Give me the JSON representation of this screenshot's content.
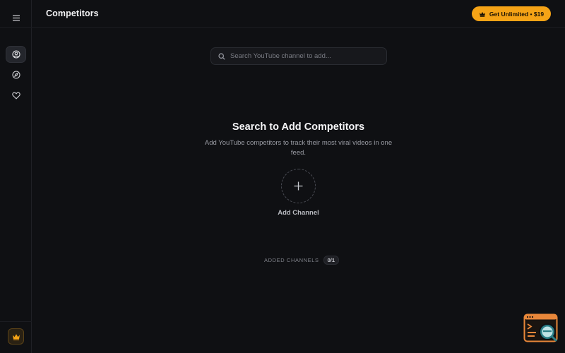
{
  "header": {
    "title": "Competitors",
    "cta_label": "Get Unlimited • $19"
  },
  "sidebar": {
    "items": [
      {
        "icon": "user-circle-icon",
        "active": true
      },
      {
        "icon": "compass-icon",
        "active": false
      },
      {
        "icon": "heart-icon",
        "active": false
      }
    ],
    "bottom_icon": "crown-icon"
  },
  "search": {
    "placeholder": "Search YouTube channel to add..."
  },
  "empty_state": {
    "title": "Search to Add Competitors",
    "description": "Add YouTube competitors to track their most viral videos in one feed.",
    "add_label": "Add Channel"
  },
  "channels": {
    "label": "ADDED CHANNELS",
    "count": "0/1"
  },
  "colors": {
    "background": "#0f1013",
    "accent": "#f5a316",
    "widget_orange": "#e8873a",
    "widget_teal": "#2a7d86"
  }
}
